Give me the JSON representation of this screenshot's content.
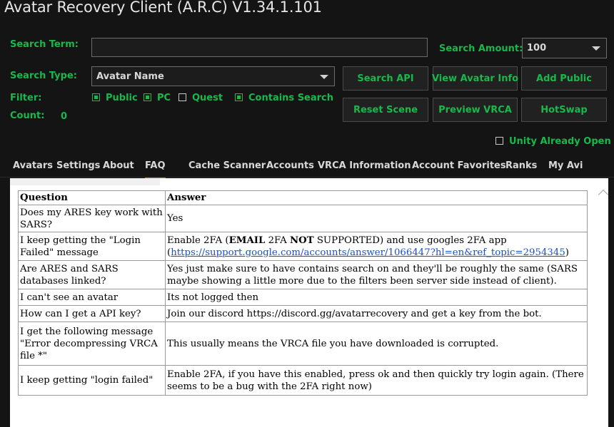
{
  "window": {
    "title": "Avatar Recovery Client (A.R.C) V1.34.1.101"
  },
  "search": {
    "term_label": "Search Term:",
    "term_value": "",
    "amount_label": "Search Amount:",
    "amount_value": "100",
    "type_label": "Search Type:",
    "type_value": "Avatar Name"
  },
  "filter": {
    "label": "Filter:",
    "options": [
      {
        "label": "Public",
        "checked": true
      },
      {
        "label": "PC",
        "checked": true
      },
      {
        "label": "Quest",
        "checked": false
      },
      {
        "label": "Contains Search",
        "checked": true
      }
    ]
  },
  "count": {
    "label": "Count:",
    "value": "0"
  },
  "buttons": {
    "search_api": "Search API",
    "view_avatar_info": "View Avatar Info",
    "add_public": "Add Public",
    "reset_scene": "Reset Scene",
    "preview_vrca": "Preview VRCA",
    "hotswap": "HotSwap"
  },
  "unity": {
    "label": "Unity Already Open",
    "checked": false
  },
  "tabs": [
    "Avatars",
    "Settings",
    "About",
    "FAQ",
    "Cache Scanner",
    "Accounts",
    "VRCA Information",
    "Account Favorites",
    "Ranks",
    "My Avi"
  ],
  "active_tab": "FAQ",
  "faq": {
    "headers": {
      "question": "Question",
      "answer": "Answer"
    },
    "rows": [
      {
        "q": "Does my ARES key work with SARS?",
        "a": "Yes"
      },
      {
        "q": "I keep getting the \"Login Failed\" message",
        "a_parts": [
          "Enable 2FA (",
          "EMAIL",
          " 2FA ",
          "NOT",
          " SUPPORTED) and use googles 2FA app",
          "(",
          "https://support.google.com/accounts/answer/1066447?hl=en&ref_topic=2954345",
          ")"
        ]
      },
      {
        "q": "Are ARES and SARS databases linked?",
        "a": "Yes just make sure to have contains search on and they'll be roughly the same (SARS maybe showing a little more due to the filters been server side instead of client)."
      },
      {
        "q": "I can't see an avatar",
        "a": "Its not logged then"
      },
      {
        "q": "How can I get a API key?",
        "a": "Join our discord https://discord.gg/avatarrecovery and get a key from the bot."
      },
      {
        "q": "I get the following message \"Error decompressing VRCA file *\"",
        "a": "This usually means the VRCA file you have downloaded is corrupted."
      },
      {
        "q": "I keep getting \"login failed\"",
        "a": "Enable 2FA, if you have this enabled, press ok and then quickly try login again. (There seems to be a bug with the 2FA right now)"
      }
    ]
  }
}
